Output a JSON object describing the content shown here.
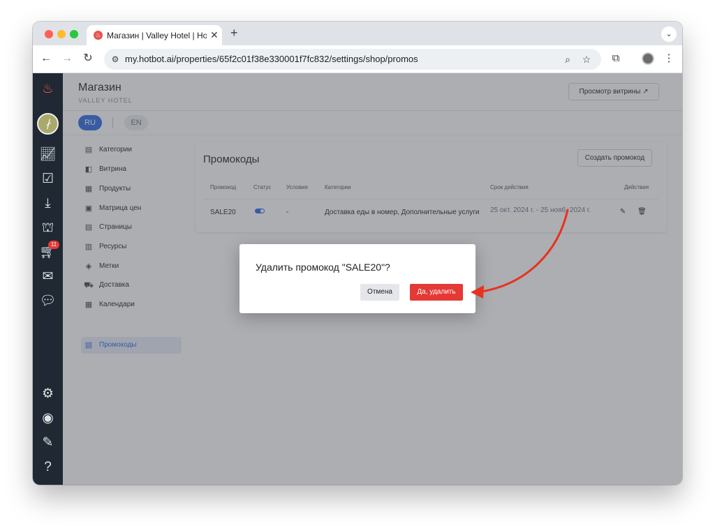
{
  "browser": {
    "tab_title": "Магазин | Valley Hotel | Hotbot",
    "url": "my.hotbot.ai/properties/65f2c01f38e330001f7fc832/settings/shop/promos"
  },
  "rail": {
    "cart_badge": "11"
  },
  "header": {
    "title": "Магазин",
    "subtitle": "VALLEY HOTEL",
    "preview_button": "Просмотр витрины ↗"
  },
  "languages": {
    "ru": "RU",
    "en": "EN"
  },
  "sidebar": {
    "items": [
      {
        "label": "Категории",
        "icon": "store-icon"
      },
      {
        "label": "Витрина",
        "icon": "showcase-icon"
      },
      {
        "label": "Продукты",
        "icon": "products-icon"
      },
      {
        "label": "Матрица цен",
        "icon": "price-matrix-icon"
      },
      {
        "label": "Страницы",
        "icon": "pages-icon"
      },
      {
        "label": "Ресурсы",
        "icon": "resources-icon"
      },
      {
        "label": "Метки",
        "icon": "tag-icon"
      },
      {
        "label": "Доставка",
        "icon": "truck-icon"
      },
      {
        "label": "Календари",
        "icon": "calendar-icon"
      },
      {
        "label": "Промокоды",
        "icon": "promo-icon"
      }
    ],
    "active_index": 9
  },
  "promos": {
    "title": "Промокоды",
    "create_button": "Создать промокод",
    "columns": [
      "Промокод",
      "Статус",
      "Условия",
      "Категории",
      "Срок действия",
      "Действия"
    ],
    "rows": [
      {
        "code": "SALE20",
        "status_enabled": true,
        "conditions": "-",
        "categories": "Доставка еды в номер, Дополнительные услуги",
        "validity": "25 окт. 2024 г. - 25 нояб. 2024 г."
      }
    ]
  },
  "dialog": {
    "title": "Удалить промокод \"SALE20\"?",
    "cancel": "Отмена",
    "confirm": "Да, удалить"
  },
  "colors": {
    "accent": "#2c6be6",
    "danger": "#e53935",
    "rail": "#1f2833",
    "annotation_arrow": "#e8321e"
  }
}
